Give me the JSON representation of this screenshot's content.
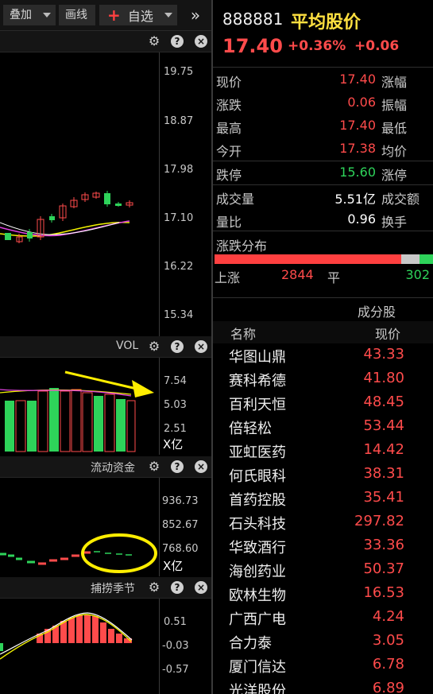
{
  "toolbar": {
    "overlay_label": "叠加",
    "draw_label": "画线",
    "watchlist_label": "自选",
    "more_icon": "double-chevron-right-icon"
  },
  "main_chart": {
    "y_ticks": [
      "19.75",
      "18.87",
      "17.98",
      "17.10",
      "16.22",
      "15.34"
    ]
  },
  "vol_panel": {
    "title": "VOL",
    "y_ticks": [
      "7.54",
      "5.03",
      "2.51"
    ],
    "unit": "X亿"
  },
  "flow_panel": {
    "title": "流动资金",
    "y_ticks": [
      "936.73",
      "852.67",
      "768.60"
    ],
    "unit": "X亿"
  },
  "season_panel": {
    "title": "捕捞季节",
    "y_ticks": [
      "0.51",
      "-0.03",
      "-0.57"
    ]
  },
  "quote": {
    "code": "888881",
    "name": "平均股价",
    "price": "17.40",
    "change_pct": "+0.36%",
    "change": "+0.06",
    "rows": [
      {
        "label": "现价",
        "value": "17.40",
        "label2": "涨幅"
      },
      {
        "label": "涨跌",
        "value": "0.06",
        "label2": "振幅"
      },
      {
        "label": "最高",
        "value": "17.40",
        "label2": "最低"
      },
      {
        "label": "今开",
        "value": "17.38",
        "label2": "均价"
      },
      {
        "label": "跌停",
        "value": "15.60",
        "label2": "涨停"
      },
      {
        "label": "成交量",
        "value": "5.51亿",
        "label2": "成交额"
      },
      {
        "label": "量比",
        "value": "0.96",
        "label2": "换手"
      }
    ]
  },
  "distribution": {
    "title": "涨跌分布",
    "up_label": "上涨",
    "up_count": "2844",
    "flat_label": "平",
    "down_count": "302",
    "up_share": 0.853,
    "flat_share": 0.085,
    "down_share": 0.062
  },
  "constituents": {
    "section_title": "成分股",
    "col_name": "名称",
    "col_price": "现价",
    "items": [
      {
        "name": "华图山鼎",
        "price": "43.33"
      },
      {
        "name": "赛科希德",
        "price": "41.80"
      },
      {
        "name": "百利天恒",
        "price": "48.45"
      },
      {
        "name": "倍轻松",
        "price": "53.44"
      },
      {
        "name": "亚虹医药",
        "price": "14.42"
      },
      {
        "name": "何氏眼科",
        "price": "38.31"
      },
      {
        "name": "首药控股",
        "price": "35.41"
      },
      {
        "name": "石头科技",
        "price": "297.82"
      },
      {
        "name": "华致酒行",
        "price": "33.36"
      },
      {
        "name": "海创药业",
        "price": "50.37"
      },
      {
        "name": "欧林生物",
        "price": "16.53"
      },
      {
        "name": "广西广电",
        "price": "4.24"
      },
      {
        "name": "合力泰",
        "price": "3.05"
      },
      {
        "name": "厦门信达",
        "price": "6.78"
      },
      {
        "name": "光洋股份",
        "price": "6.89"
      }
    ]
  },
  "colors": {
    "up": "#ff4b4b",
    "down": "#2ed35a",
    "annotation": "#ffee00"
  }
}
